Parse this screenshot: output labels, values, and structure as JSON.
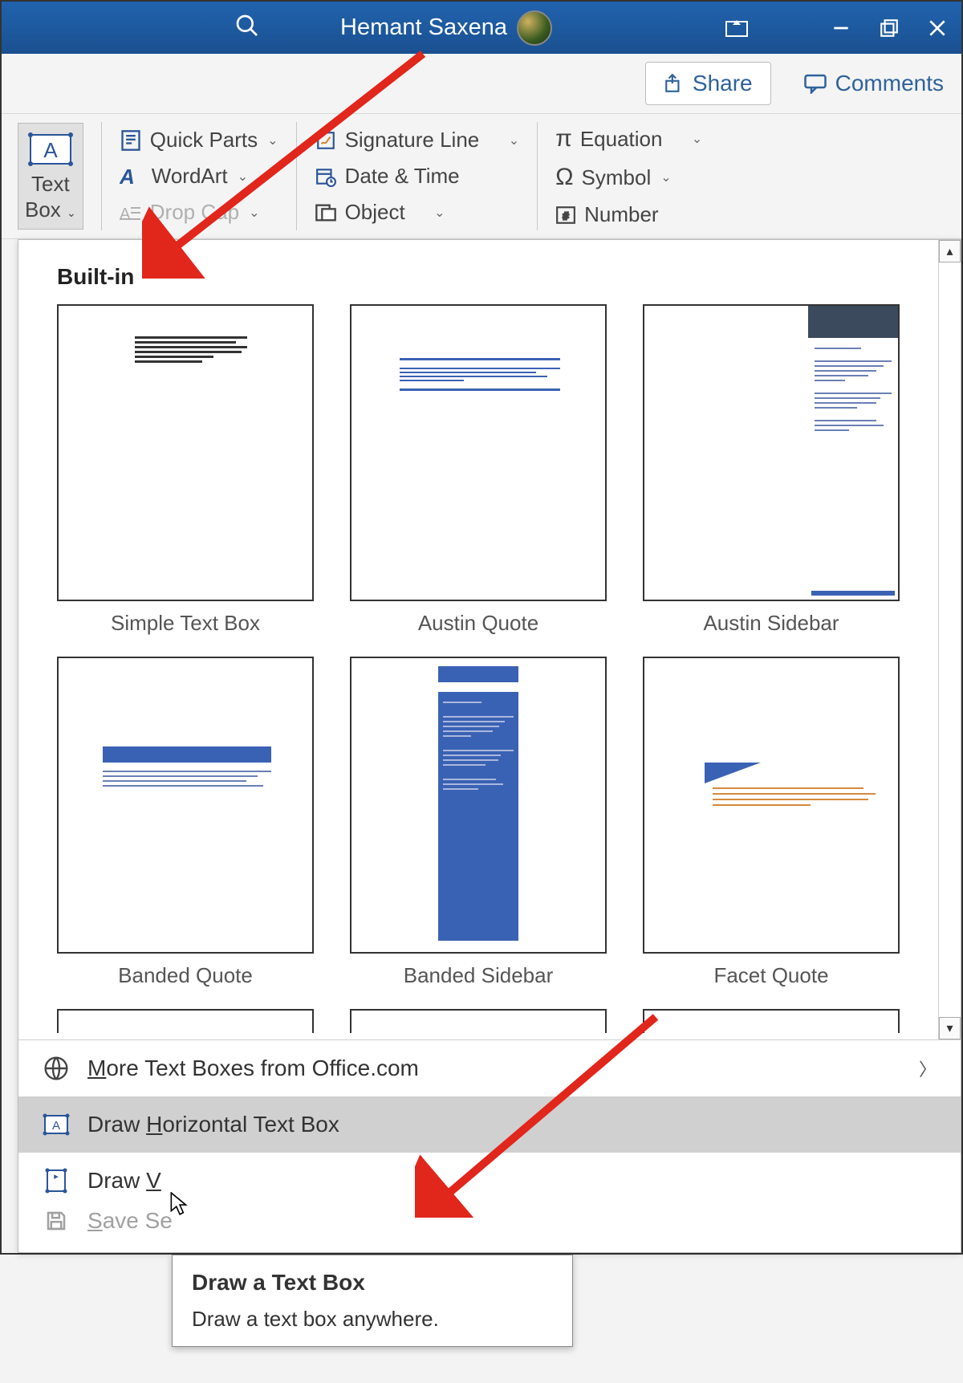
{
  "title": {
    "user": "Hemant Saxena"
  },
  "share": {
    "share_label": "Share",
    "comments_label": "Comments"
  },
  "ribbon": {
    "textbox": {
      "line1": "Text",
      "line2": "Box"
    },
    "quick_parts": "Quick Parts",
    "wordart": "WordArt",
    "drop_cap": "Drop Cap",
    "sig_line": "Signature Line",
    "date_time": "Date & Time",
    "object": "Object",
    "equation": "Equation",
    "symbol": "Symbol",
    "number": "Number"
  },
  "gallery": {
    "header": "Built-in",
    "items": [
      {
        "label": "Simple Text Box"
      },
      {
        "label": "Austin Quote"
      },
      {
        "label": "Austin Sidebar"
      },
      {
        "label": "Banded Quote"
      },
      {
        "label": "Banded Sidebar"
      },
      {
        "label": "Facet Quote"
      }
    ],
    "more": "ore Text Boxes from Office.com",
    "more_prefix": "M",
    "draw_h_prefix": "Draw ",
    "draw_h_accel": "H",
    "draw_h_suffix": "orizontal Text Box",
    "draw_v_prefix": "Draw ",
    "draw_v_accel": "V",
    "save_prefix": "S",
    "save_suffix": "ave Se"
  },
  "tooltip": {
    "title": "Draw a Text Box",
    "body": "Draw a text box anywhere."
  }
}
